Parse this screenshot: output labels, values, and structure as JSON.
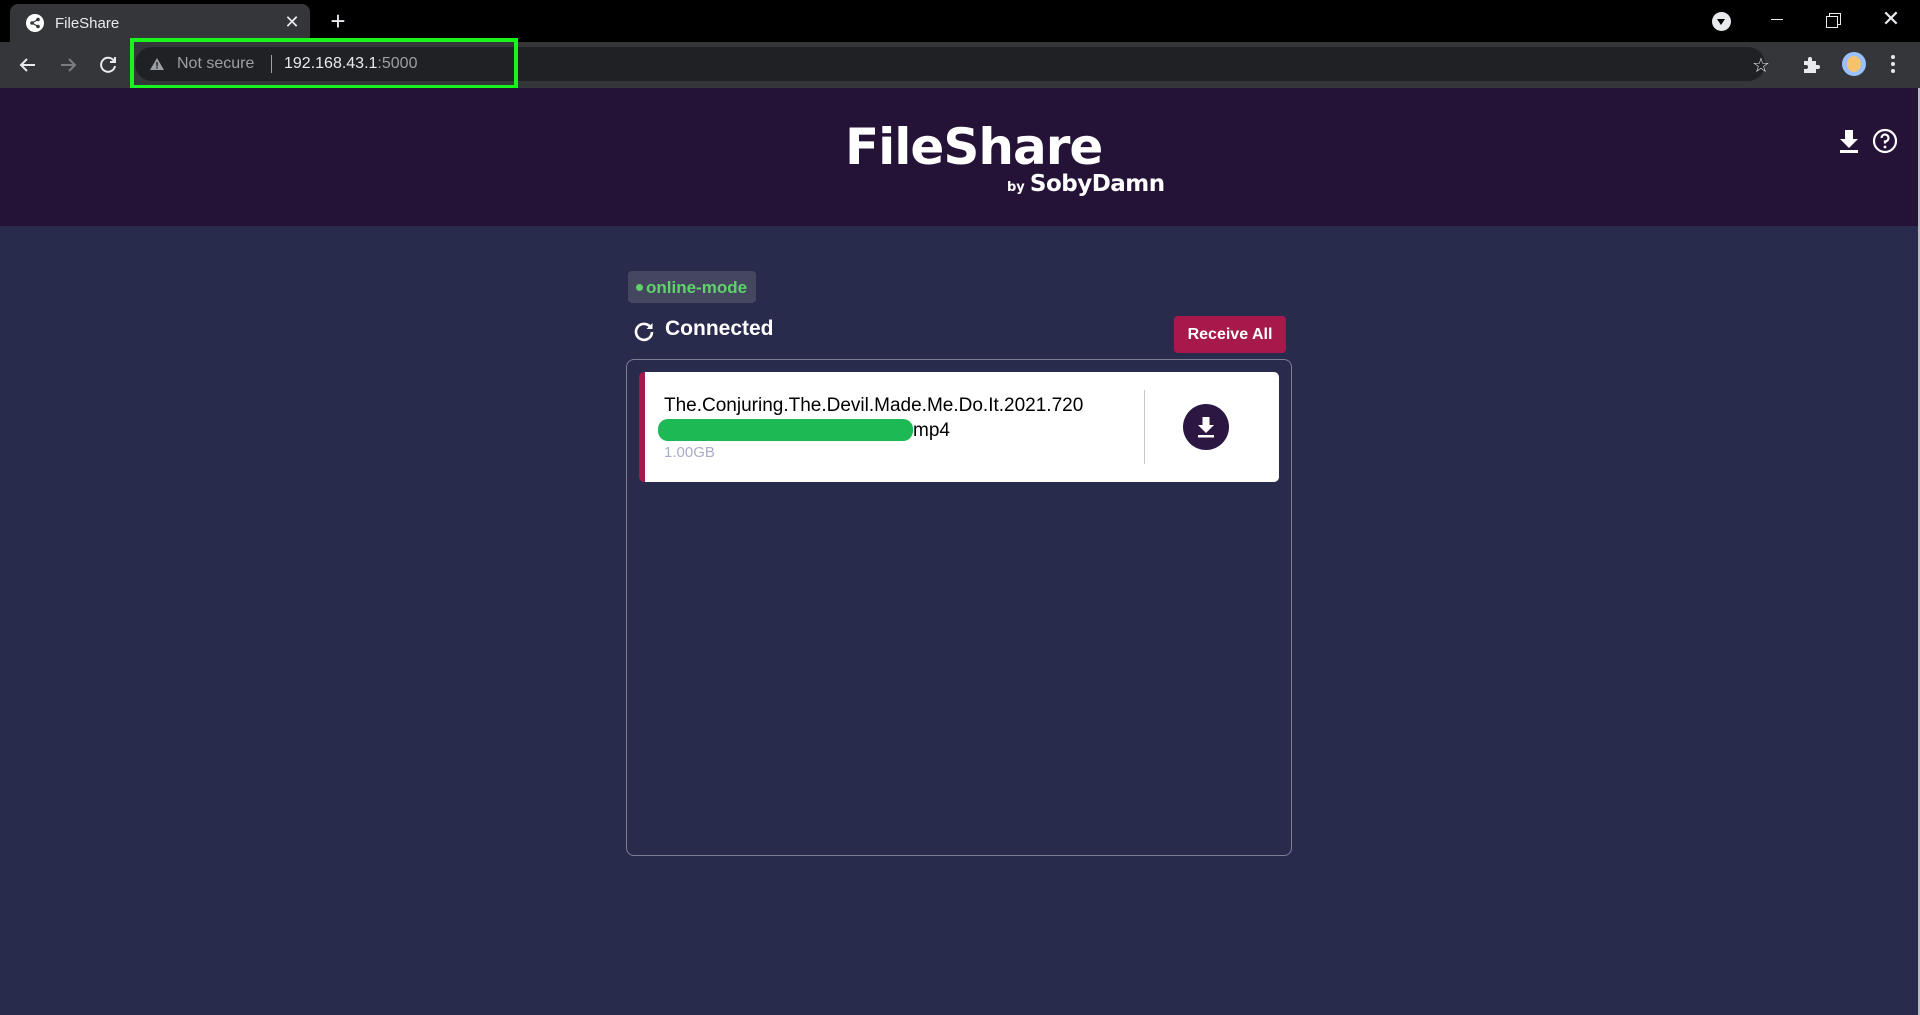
{
  "browser": {
    "tab_title": "FileShare",
    "new_tab_symbol": "+",
    "close_symbol": "✕",
    "omnibox": {
      "security_label": "Not secure",
      "url_host": "192.168.43.1",
      "url_port": ":5000"
    },
    "icons": [
      "back-arrow-icon",
      "forward-arrow-icon",
      "reload-icon",
      "warning-icon",
      "star-icon",
      "extensions-icon",
      "profile-avatar",
      "menu-kebab-icon"
    ]
  },
  "header": {
    "title": "FileShare",
    "by": "by",
    "author": "SobyDamn"
  },
  "mode_badge": "online-mode",
  "status": "Connected",
  "receive_all_label": "Receive All",
  "files": [
    {
      "name_line1": "The.Conjuring.The.Devil.Made.Me.Do.It.2021.720",
      "name_line2_suffix": "mp4",
      "size": "1.00GB"
    }
  ],
  "colors": {
    "header_bg": "#241336",
    "page_bg": "#292b4d",
    "accent": "#a7194a",
    "online_green": "#5fd36a",
    "highlight_box": "#18f51c"
  }
}
